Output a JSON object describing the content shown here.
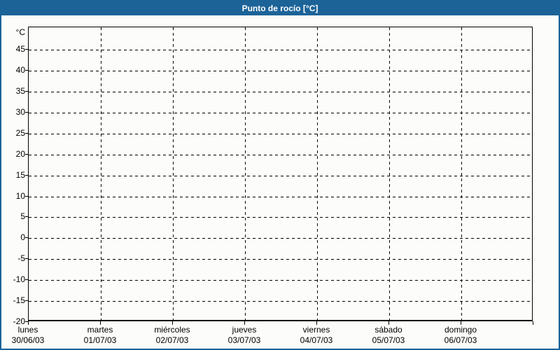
{
  "window": {
    "title": "Punto de rocío [°C]"
  },
  "colors": {
    "accent_blue": "#1C6398",
    "background": "#FCFDFA",
    "grid_and_text": "#000000",
    "title_text": "#FFFFFF"
  },
  "chart_data": {
    "type": "line",
    "title": "Punto de rocío [°C]",
    "y_unit_label": "°C",
    "ylabel": "",
    "xlabel": "",
    "ylim": [
      -20,
      50.4
    ],
    "ytick_values": [
      45,
      40,
      35,
      30,
      25,
      20,
      15,
      10,
      5,
      0,
      -5,
      -10,
      -15,
      -20
    ],
    "ygrid_values": [
      45,
      40,
      35,
      30,
      25,
      20,
      15,
      10,
      5,
      0,
      -5,
      -10,
      -15
    ],
    "grid_style": "dashed",
    "num_days": 7,
    "categories": [
      {
        "day": "lunes",
        "date": "30/06/03"
      },
      {
        "day": "martes",
        "date": "01/07/03"
      },
      {
        "day": "miércoles",
        "date": "02/07/03"
      },
      {
        "day": "jueves",
        "date": "03/07/03"
      },
      {
        "day": "viernes",
        "date": "04/07/03"
      },
      {
        "day": "sábado",
        "date": "05/07/03"
      },
      {
        "day": "domingo",
        "date": "06/07/03"
      }
    ],
    "series": []
  }
}
